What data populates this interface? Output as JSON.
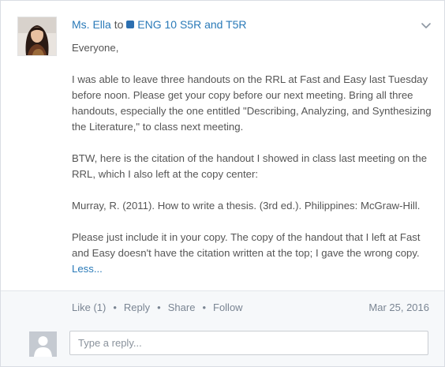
{
  "post": {
    "author": "Ms. Ella",
    "to_word": "to",
    "group": "ENG 10 S5R and T5R",
    "group_color": "#2c6fb0",
    "paragraphs": [
      "Everyone,",
      "I was able to leave three handouts on the RRL at Fast and Easy last Tuesday before noon. Please get your copy before our next meeting. Bring all three handouts, especially the one entitled \"Describing, Analyzing, and Synthesizing the Literature,\" to class next meeting.",
      "BTW, here is the citation of the handout I showed in class last meeting on the RRL, which I also left at the copy center:",
      "Murray, R. (2011). How to write a thesis. (3rd ed.). Philippines: McGraw-Hill.",
      "Please just include it in your copy. The copy of the handout that I left at Fast and Easy doesn't have the citation written at the top; I gave the wrong copy."
    ],
    "less_label": "Less...",
    "menu_icon": "chevron-down-icon"
  },
  "footer": {
    "like_label": "Like (1)",
    "reply_label": "Reply",
    "share_label": "Share",
    "follow_label": "Follow",
    "separator": "•",
    "date": "Mar 25, 2016"
  },
  "reply": {
    "placeholder": "Type a reply...",
    "avatar_icon": "default-user-icon"
  },
  "colors": {
    "link": "#2a7ab8",
    "footer_bg": "#f6f8fa",
    "meta_text": "#7a8593"
  }
}
